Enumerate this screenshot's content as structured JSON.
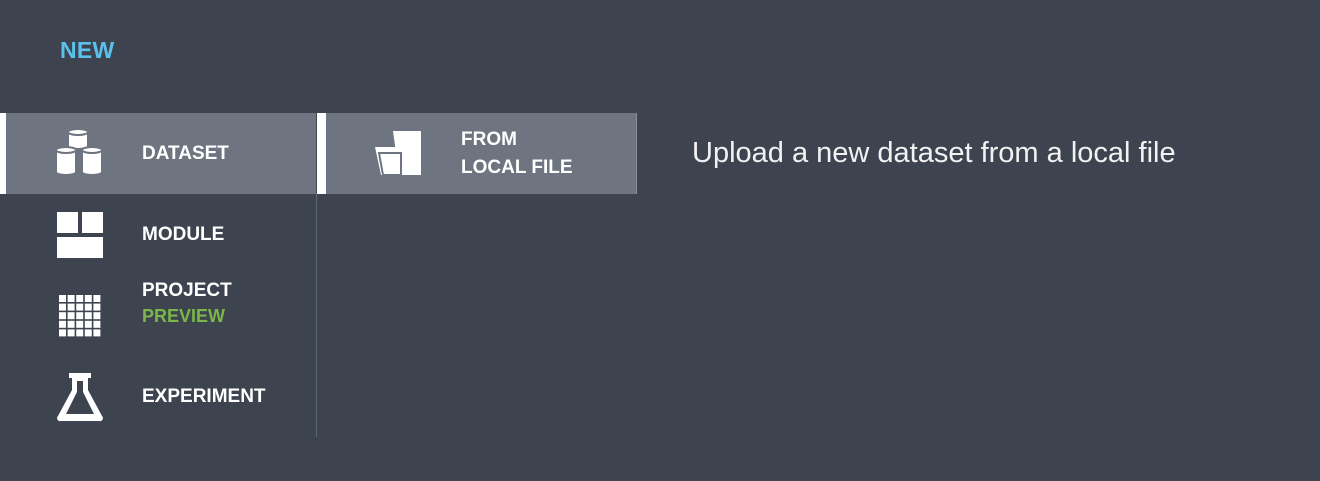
{
  "header": {
    "title": "NEW"
  },
  "categories": [
    {
      "label": "DATASET",
      "icon": "database-cylinders-icon",
      "selected": true
    },
    {
      "label": "MODULE",
      "icon": "module-blocks-icon"
    },
    {
      "label": "PROJECT",
      "sublabel": "PREVIEW",
      "icon": "project-grid-icon"
    },
    {
      "label": "EXPERIMENT",
      "icon": "flask-icon"
    }
  ],
  "options": [
    {
      "line1": "FROM",
      "line2": "LOCAL FILE",
      "icon": "folder-open-icon",
      "selected": true
    }
  ],
  "description": "Upload a new dataset from a local file",
  "colors": {
    "accent": "#5bc0eb",
    "preview": "#7ab648",
    "background": "#3d4450",
    "selected": "#6e7580"
  }
}
